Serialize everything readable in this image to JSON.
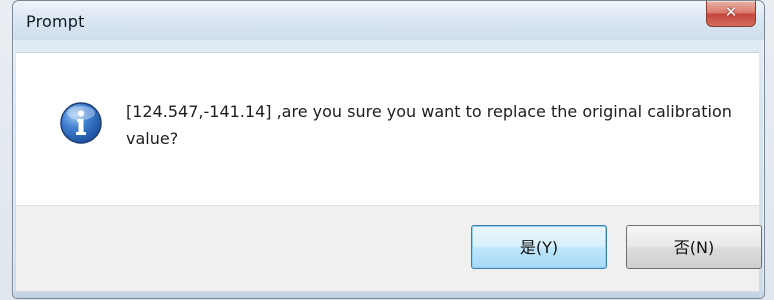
{
  "window": {
    "title": "Prompt",
    "close_icon": "close-icon"
  },
  "dialog": {
    "icon": "info-icon",
    "message": "[124.547,-141.14] ,are you sure you want to replace the original calibration value?",
    "buttons": {
      "yes_label": "是(Y)",
      "no_label": "否(N)"
    }
  },
  "colors": {
    "info_icon": "#2f64b3",
    "close_button": "#d9786a",
    "default_button_border": "#3c7fb1",
    "content_background": "#ffffff",
    "footer_background": "#f0f0f0"
  }
}
